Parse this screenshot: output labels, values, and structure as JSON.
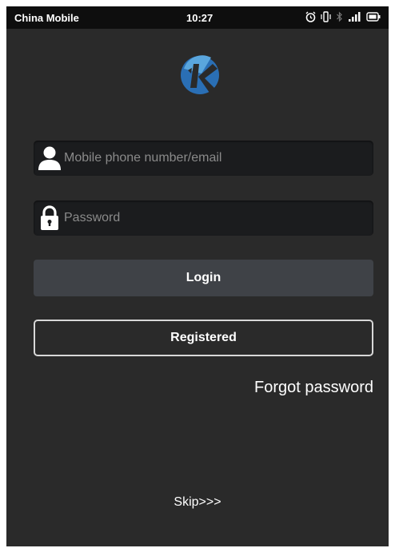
{
  "status_bar": {
    "carrier": "China Mobile",
    "time": "10:27",
    "icons": [
      "alarm-icon",
      "vibrate-icon",
      "bluetooth-icon",
      "signal-icon",
      "battery-icon"
    ]
  },
  "logo": {
    "icon": "app-logo-icon",
    "colors": [
      "#2a6fb5",
      "#5aa6dd"
    ]
  },
  "login_form": {
    "username": {
      "placeholder": "Mobile phone number/email",
      "value": "",
      "icon": "user-icon"
    },
    "password": {
      "placeholder": "Password",
      "value": "",
      "icon": "lock-icon"
    },
    "login_label": "Login",
    "register_label": "Registered",
    "forgot_label": "Forgot password"
  },
  "skip_label": "Skip>>>",
  "colors": {
    "background": "#2a2a2a",
    "status_bar": "#0e0e0e",
    "field_bg": "#1b1c1e",
    "login_button": "#3f4247",
    "text": "#ffffff",
    "placeholder": "#8a8a8a"
  }
}
